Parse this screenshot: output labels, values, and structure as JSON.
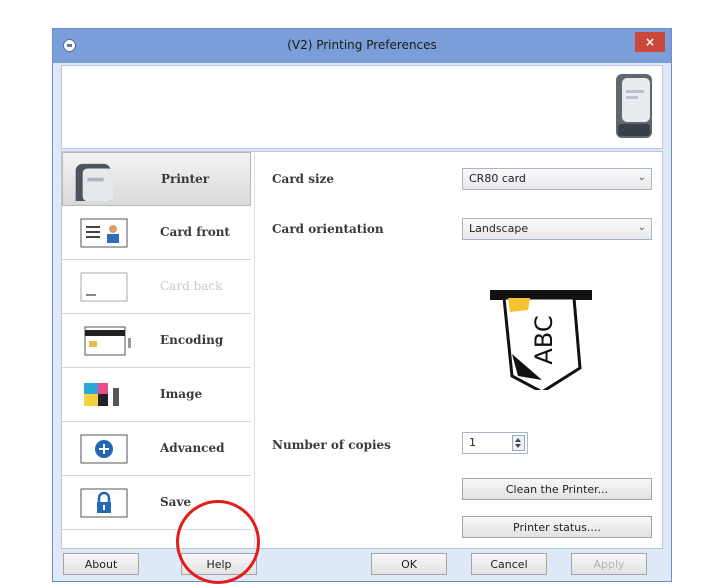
{
  "window": {
    "title": "(V2) Printing Preferences",
    "close_symbol": "×"
  },
  "sidebar": {
    "items": [
      {
        "label": "Printer",
        "icon": "printer-icon",
        "active": true
      },
      {
        "label": "Card front",
        "icon": "card-front-icon"
      },
      {
        "label": "Card back",
        "icon": "card-back-icon",
        "disabled": true
      },
      {
        "label": "Encoding",
        "icon": "encoding-icon"
      },
      {
        "label": "Image",
        "icon": "image-icon"
      },
      {
        "label": "Advanced",
        "icon": "advanced-icon"
      },
      {
        "label": "Save",
        "icon": "lock-icon"
      }
    ]
  },
  "printer_panel": {
    "card_size": {
      "label": "Card size",
      "value": "CR80 card"
    },
    "card_orientation": {
      "label": "Card orientation",
      "value": "Landscape"
    },
    "illustration_text": "ABC",
    "copies": {
      "label": "Number of copies",
      "value": "1"
    },
    "clean_button": "Clean the Printer...",
    "status_button": "Printer status...."
  },
  "footer": {
    "about": "About",
    "help": "Help",
    "ok": "OK",
    "cancel": "Cancel",
    "apply": "Apply"
  },
  "colors": {
    "annotation": "#e41c1c",
    "titlebar": "#7a9fd8",
    "close": "#c9483b"
  }
}
